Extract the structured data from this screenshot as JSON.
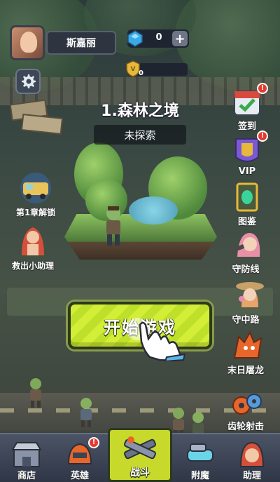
{
  "player": {
    "name": "斯嘉丽"
  },
  "currency": {
    "gems": "0",
    "plus_symbol": "+"
  },
  "vip": {
    "level": "0"
  },
  "stage": {
    "title": "1.森林之境",
    "status": "未探索"
  },
  "start_button": {
    "label": "开始游戏"
  },
  "left_features": [
    {
      "label": "第1章解锁"
    },
    {
      "label": "救出小助理"
    }
  ],
  "right_features": [
    {
      "label": "签到",
      "badge": "!"
    },
    {
      "label": "VIP",
      "badge": "!"
    },
    {
      "label": "图鉴"
    },
    {
      "label": "守防线"
    },
    {
      "label": "守中路"
    },
    {
      "label": "末日屠龙"
    },
    {
      "label": "齿轮射击"
    }
  ],
  "bottom_nav": [
    {
      "label": "商店"
    },
    {
      "label": "英雄",
      "badge": "!"
    },
    {
      "label": "战斗",
      "active": true
    },
    {
      "label": "附魔"
    },
    {
      "label": "助理"
    }
  ],
  "colors": {
    "accent": "#c7d92a",
    "badge_red": "#e63a2e",
    "panel_dark": "#2f3540"
  }
}
